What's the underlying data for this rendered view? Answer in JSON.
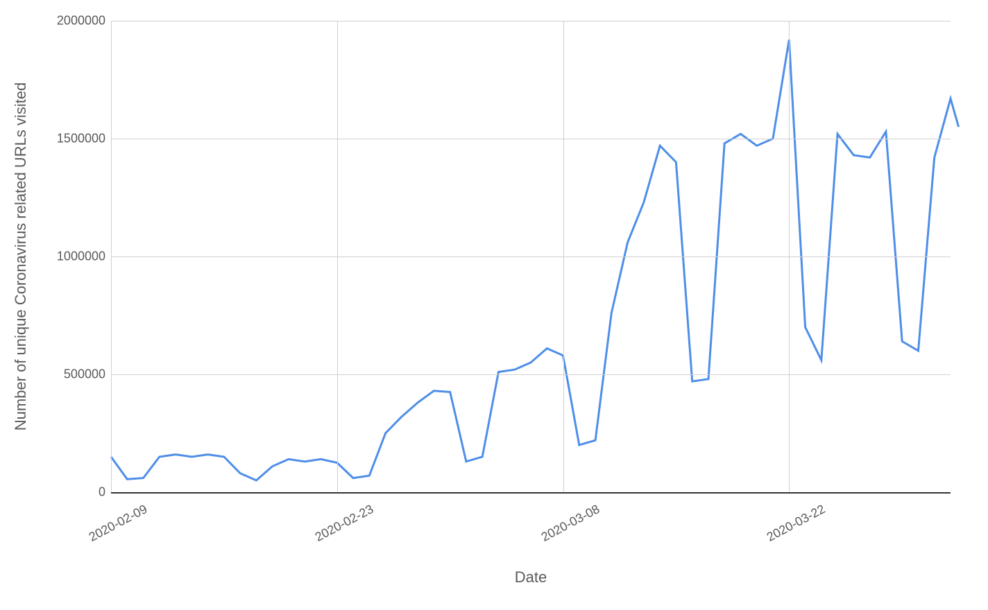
{
  "chart_data": {
    "type": "line",
    "title": "",
    "xlabel": "Date",
    "ylabel": "Number of unique Coronavirus related URLs visited",
    "ylim": [
      0,
      2000000
    ],
    "y_ticks": [
      0,
      500000,
      1000000,
      1500000,
      2000000
    ],
    "x_tick_labels": [
      "2020-02-09",
      "2020-02-23",
      "2020-03-08",
      "2020-03-22"
    ],
    "x_tick_indices": [
      0,
      14,
      28,
      42
    ],
    "categories": [
      "2020-02-09",
      "2020-02-10",
      "2020-02-11",
      "2020-02-12",
      "2020-02-13",
      "2020-02-14",
      "2020-02-15",
      "2020-02-16",
      "2020-02-17",
      "2020-02-18",
      "2020-02-19",
      "2020-02-20",
      "2020-02-21",
      "2020-02-22",
      "2020-02-23",
      "2020-02-24",
      "2020-02-25",
      "2020-02-26",
      "2020-02-27",
      "2020-02-28",
      "2020-02-29",
      "2020-03-01",
      "2020-03-02",
      "2020-03-03",
      "2020-03-04",
      "2020-03-05",
      "2020-03-06",
      "2020-03-07",
      "2020-03-08",
      "2020-03-09",
      "2020-03-10",
      "2020-03-11",
      "2020-03-12",
      "2020-03-13",
      "2020-03-14",
      "2020-03-15",
      "2020-03-16",
      "2020-03-17",
      "2020-03-18",
      "2020-03-19",
      "2020-03-20",
      "2020-03-21",
      "2020-03-22",
      "2020-03-23",
      "2020-03-24",
      "2020-03-25",
      "2020-03-26",
      "2020-03-27",
      "2020-03-28",
      "2020-03-29",
      "2020-03-30",
      "2020-03-31",
      "2020-04-01"
    ],
    "series": [
      {
        "name": "Unique Coronavirus related URLs visited",
        "color": "#4e8ee8",
        "values": [
          150000,
          55000,
          60000,
          150000,
          160000,
          150000,
          160000,
          150000,
          80000,
          50000,
          110000,
          140000,
          130000,
          140000,
          125000,
          60000,
          70000,
          250000,
          320000,
          380000,
          430000,
          425000,
          130000,
          150000,
          510000,
          520000,
          550000,
          610000,
          580000,
          200000,
          220000,
          760000,
          1060000,
          1230000,
          1470000,
          1400000,
          470000,
          480000,
          1480000,
          1520000,
          1470000,
          1500000,
          1920000,
          700000,
          560000,
          1520000,
          1430000,
          1420000,
          1530000,
          640000,
          600000,
          1420000,
          1670000
        ]
      }
    ],
    "last_point_value": 1550000
  }
}
